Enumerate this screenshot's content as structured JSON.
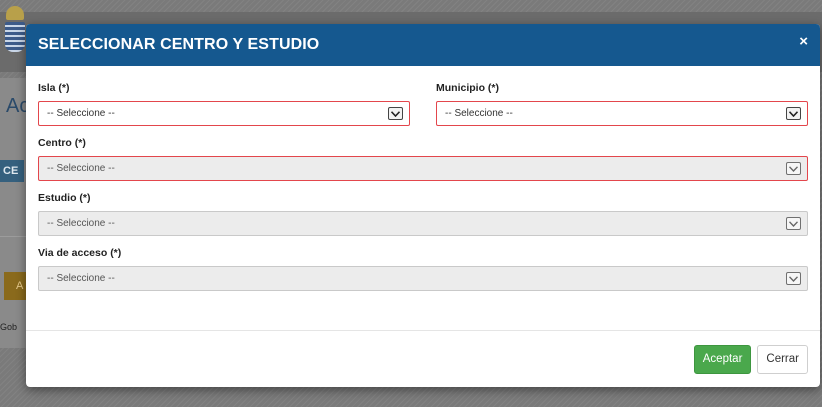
{
  "modal": {
    "title": "SELECCIONAR CENTRO Y ESTUDIO",
    "close_icon": "×",
    "fields": {
      "isla": {
        "label": "Isla (*)",
        "value": "-- Seleccione --"
      },
      "municipio": {
        "label": "Municipio (*)",
        "value": "-- Seleccione --"
      },
      "centro": {
        "label": "Centro (*)",
        "value": "-- Seleccione --"
      },
      "estudio": {
        "label": "Estudio (*)",
        "value": "-- Seleccione --"
      },
      "via_acceso": {
        "label": "Via de acceso (*)",
        "value": "-- Seleccione --"
      }
    },
    "buttons": {
      "accept": "Aceptar",
      "close": "Cerrar"
    }
  },
  "background": {
    "heading_fragment": "Ac",
    "tag_fragment": "CE",
    "button_fragment": "A",
    "footer_fragment": "Gob"
  },
  "colors": {
    "header": "#15588f",
    "invalid_border": "#e3464c",
    "primary_button": "#4aa84c"
  },
  "icons": {
    "close": "close-icon",
    "dropdown": "chevron-down-icon",
    "crest": "crest-icon"
  }
}
